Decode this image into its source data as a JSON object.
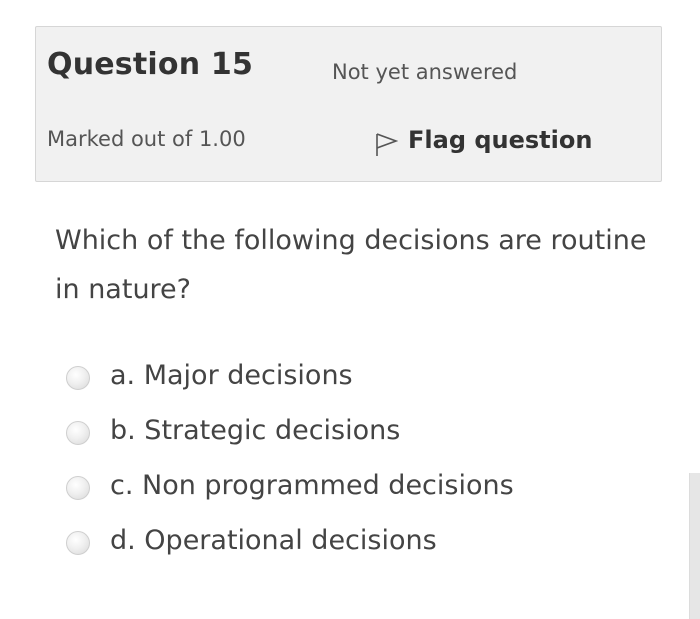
{
  "info": {
    "title": "Question 15",
    "state": "Not yet answered",
    "grade": "Marked out of 1.00",
    "flag_label": "Flag question"
  },
  "question": {
    "text": "Which of the following decisions are routine in nature?"
  },
  "answers": [
    {
      "label": "a. Major decisions"
    },
    {
      "label": "b. Strategic decisions"
    },
    {
      "label": "c. Non programmed decisions"
    },
    {
      "label": "d. Operational decisions"
    }
  ],
  "icons": {
    "flag": "flag-icon"
  }
}
